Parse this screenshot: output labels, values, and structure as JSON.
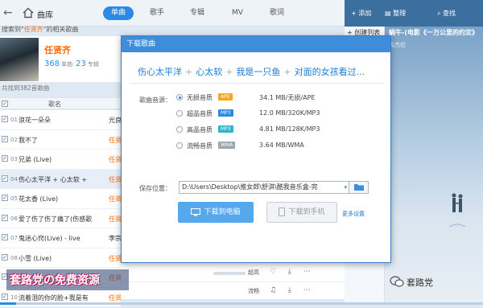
{
  "header": {
    "library_label": "曲库",
    "tabs": [
      {
        "label": "单曲",
        "active": true
      },
      {
        "label": "歌手",
        "active": false
      },
      {
        "label": "专辑",
        "active": false
      },
      {
        "label": "MV",
        "active": false
      },
      {
        "label": "歌词",
        "active": false
      }
    ]
  },
  "search": {
    "prefix": "搜索到\"",
    "keyword": "任贤齐",
    "suffix": "\"的相关歌曲"
  },
  "singer": {
    "name": "任贤齐",
    "songs_count": "368",
    "songs_label": "单曲",
    "albums_count": "23",
    "albums_label": "专辑"
  },
  "list": {
    "total_text": "共找到382首歌曲",
    "column_title": "歌名",
    "rows": [
      {
        "no": "01",
        "name": "浪花一朵朵",
        "artist": "光良",
        "artist_orange": false,
        "selected": false
      },
      {
        "no": "02",
        "name": "我不了",
        "artist": "任贤",
        "artist_orange": true,
        "selected": false
      },
      {
        "no": "03",
        "name": "兄弟 (Live)",
        "artist": "任贤",
        "artist_orange": true,
        "selected": false
      },
      {
        "no": "04",
        "name": "伤心太平洋 + 心太软 + ",
        "artist": "任贤",
        "artist_orange": true,
        "selected": true
      },
      {
        "no": "05",
        "name": "花太香 (Live)",
        "artist": "任贤",
        "artist_orange": true,
        "selected": false
      },
      {
        "no": "06",
        "name": "爱了伤了伤了痛了(伤感歌",
        "artist": "任贤",
        "artist_orange": true,
        "selected": false
      },
      {
        "no": "07",
        "name": "鬼迷心窍(Live) - live",
        "artist": "李宗",
        "artist_orange": false,
        "selected": false
      },
      {
        "no": "08",
        "name": "小雪 (Live)",
        "artist": "任贤",
        "artist_orange": true,
        "selected": false
      },
      {
        "no": "09",
        "name": "",
        "artist": "任贤",
        "artist_orange": true,
        "selected": false
      },
      {
        "no": "10",
        "name": "流着泪的你的脸+我是有",
        "artist": "任贤",
        "artist_orange": true,
        "selected": false
      }
    ]
  },
  "bottom_rows": [
    {
      "quality": "超高"
    },
    {
      "quality": "流畅"
    }
  ],
  "watermark": "套路党の免费资源",
  "right_panel": {
    "add_label": "添加",
    "arrange_label": "整理",
    "find_label": "查找",
    "new_list_label": "创建列表",
    "now_playing": "蜗牛-(电影《一万公里的约定》",
    "now_artist": "周杰伦",
    "brand": "套路党"
  },
  "dialog": {
    "title": "下载歌曲",
    "songs_line": [
      "伤心太平洋",
      "心太软",
      "我是一只鱼",
      "对面的女孩看过..."
    ],
    "source_label": "歌曲音源：",
    "options": [
      {
        "quality": "无损音质",
        "badge": "APE",
        "badge_color": "#f5a623",
        "size": "34.1 MB/无损/APE",
        "checked": true
      },
      {
        "quality": "超品音质",
        "badge": "MP3",
        "badge_color": "#2a8ae6",
        "size": "12.0 MB/320K/MP3",
        "checked": false
      },
      {
        "quality": "高品音质",
        "badge": "MP3",
        "badge_color": "#2fb5c8",
        "size": "4.81 MB/128K/MP3",
        "checked": false
      },
      {
        "quality": "流畅音质",
        "badge": "WMA",
        "badge_color": "#9aa6b2",
        "size": "3.64 MB/WMA",
        "checked": false
      }
    ],
    "save_label": "保存位置：",
    "save_path": "D:\\Users\\Desktop\\推女郎\\舒淇\\酷我音乐盒-完",
    "download_pc": "下载到电脑",
    "download_phone": "下载到手机",
    "more_settings": "更多设置"
  }
}
